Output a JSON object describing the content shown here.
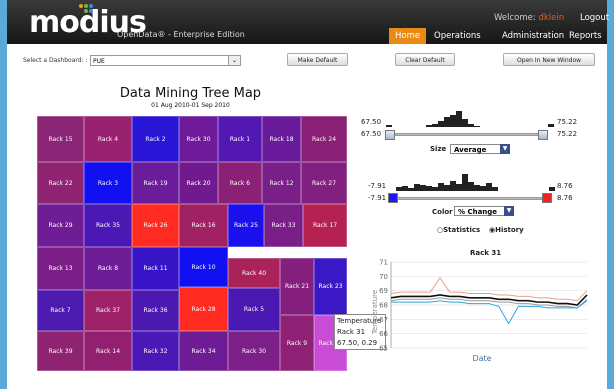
{
  "header": {
    "logo": "modius",
    "edition": "OpenData® - Enterprise Edition",
    "welcome_label": "Welcome:",
    "username": "dklein",
    "logout": "Logout",
    "nav": [
      "Home",
      "Operations",
      "Administration",
      "Reports"
    ],
    "active_nav": "Home"
  },
  "toolbar": {
    "dashboard_label": "Select a Dashboard: :",
    "dashboard_value": "PUE",
    "make_default": "Make Default",
    "clear_default": "Clear Default",
    "open_new_window": "Open In New Window"
  },
  "treemap": {
    "title": "Data Mining Tree Map",
    "subtitle": "01 Aug 2010-01 Sep 2010",
    "cells": [
      "Rack 15",
      "Rack 4",
      "Rack 2",
      "Rack 30",
      "Rack 1",
      "Rack 18",
      "Rack 24",
      "Rack 22",
      "Rack 3",
      "Rack 19",
      "Rack 20",
      "Rack 6",
      "Rack 12",
      "Rack 27",
      "Rack 29",
      "Rack 35",
      "Rack 26",
      "Rack 16",
      "Rack 25",
      "Rack 33",
      "Rack 17",
      "Rack 13",
      "Rack 8",
      "Rack 11",
      "Rack 10",
      "Rack 40",
      "Rack 21",
      "Rack 23",
      "Rack 7",
      "Rack 37",
      "Rack 36",
      "Rack 28",
      "Rack 5",
      "Rack 39",
      "Rack 14",
      "Rack 32",
      "Rack 34",
      "Rack 30",
      "Rack 9",
      "Rack 31"
    ],
    "tooltip": {
      "metric": "Temperature",
      "rack": "Rack 31",
      "values": "67.50, 0.29"
    }
  },
  "size_control": {
    "min_top": "67.50",
    "max_top": "75.22",
    "min": "67.50",
    "max": "75.22",
    "label": "Size",
    "value": "Average"
  },
  "color_control": {
    "min_top": "-7.91",
    "max_top": "8.76",
    "min": "-7.91",
    "max": "8.76",
    "label": "Color",
    "value": "% Change",
    "min_color": "#1a1aee",
    "max_color": "#ee2222"
  },
  "view_toggle": {
    "options": [
      "Statistics",
      "History"
    ],
    "selected": "History"
  },
  "line_chart": {
    "title": "Rack 31",
    "xlabel": "Date",
    "ylabel": "Temperature"
  },
  "chart_data": {
    "type": "line",
    "title": "Rack 31",
    "xlabel": "Date",
    "ylabel": "Temperature",
    "ylim": [
      65,
      71
    ],
    "yticks": [
      65,
      66,
      67,
      68,
      69,
      70,
      71
    ],
    "x": [
      0,
      1,
      2,
      3,
      4,
      5,
      6,
      7,
      8,
      9,
      10,
      11,
      12,
      13,
      14,
      15,
      16,
      17,
      18,
      19,
      20
    ],
    "series": [
      {
        "color": "#e8a08a",
        "values": [
          68.8,
          68.9,
          68.9,
          68.9,
          68.9,
          69.9,
          68.9,
          68.9,
          68.8,
          68.8,
          68.8,
          68.7,
          68.7,
          68.6,
          68.6,
          68.5,
          68.5,
          68.4,
          68.4,
          68.3,
          69.0
        ]
      },
      {
        "color": "#111111",
        "values": [
          68.5,
          68.6,
          68.6,
          68.6,
          68.6,
          68.7,
          68.6,
          68.6,
          68.5,
          68.5,
          68.5,
          68.4,
          68.4,
          68.3,
          68.3,
          68.2,
          68.2,
          68.1,
          68.1,
          68.0,
          68.7
        ]
      },
      {
        "color": "#999999",
        "values": [
          68.3,
          68.4,
          68.4,
          68.4,
          68.4,
          68.5,
          68.4,
          68.4,
          68.3,
          68.3,
          68.3,
          68.2,
          68.2,
          68.1,
          68.1,
          68.0,
          68.0,
          67.9,
          67.9,
          67.8,
          68.4
        ]
      },
      {
        "color": "#2aa8d8",
        "values": [
          68.2,
          68.2,
          68.2,
          68.2,
          68.2,
          68.3,
          68.2,
          68.2,
          68.1,
          68.1,
          68.1,
          67.9,
          66.7,
          67.9,
          67.9,
          67.9,
          67.8,
          67.8,
          67.8,
          67.8,
          68.3
        ]
      }
    ]
  }
}
